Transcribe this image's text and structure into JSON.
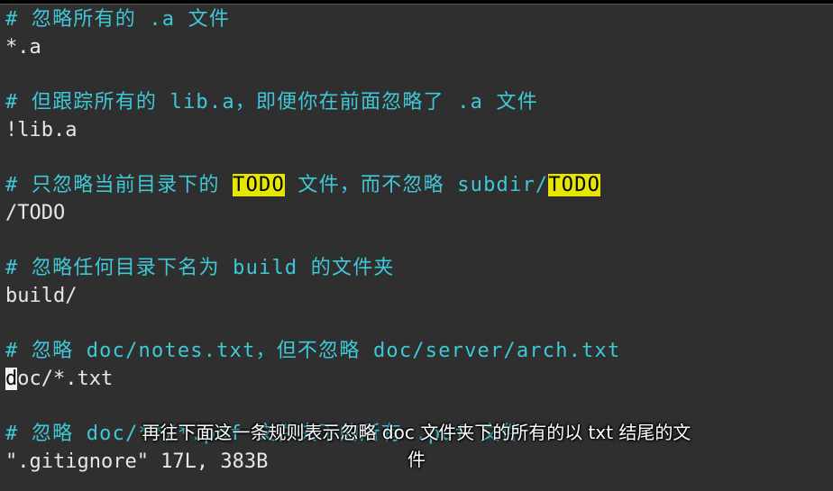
{
  "editor": {
    "lines": {
      "l1": "# 忽略所有的 .a 文件",
      "l2": "*.a",
      "l4": "# 但跟踪所有的 lib.a，即便你在前面忽略了 .a 文件",
      "l5": "!lib.a",
      "l7_a": "# 只忽略当前目录下的 ",
      "l7_todo1": "TODO",
      "l7_b": " 文件，而不忽略 subdir/",
      "l7_todo2": "TODO",
      "l8": "/TODO",
      "l10": "# 忽略任何目录下名为 build 的文件夹",
      "l11": "build/",
      "l13": "# 忽略 doc/notes.txt，但不忽略 doc/server/arch.txt",
      "l14_cursor": "d",
      "l14_rest": "oc/*.txt",
      "l16": "# 忽略 doc/**/*.pdf 文件夹下的所有 .pdf 文件"
    },
    "status_line": "\".gitignore\" 17L, 383B"
  },
  "subtitle": {
    "line1": "再往下面这一条规则表示忽略 doc 文件夹下的所有的以 txt 结尾的文",
    "line2": "件"
  },
  "colors": {
    "background": "#2f2f2f",
    "comment": "#3fc8d8",
    "highlight": "#e6e600",
    "text": "#e7e7e7"
  }
}
